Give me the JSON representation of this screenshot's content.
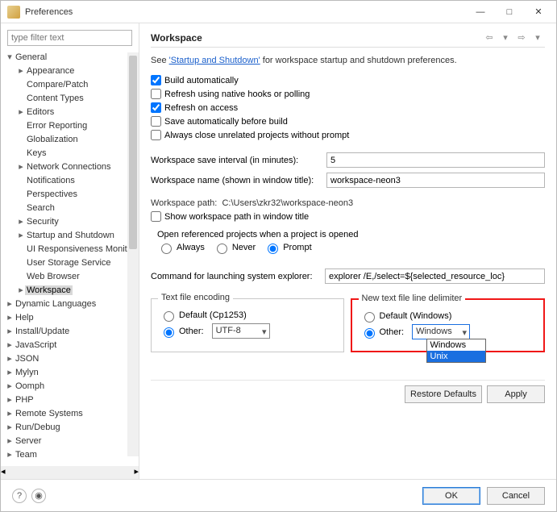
{
  "window": {
    "title": "Preferences"
  },
  "filter": {
    "placeholder": "type filter text"
  },
  "tree": {
    "general": "General",
    "general_items": [
      "Appearance",
      "Compare/Patch",
      "Content Types",
      "Editors",
      "Error Reporting",
      "Globalization",
      "Keys",
      "Network Connections",
      "Notifications",
      "Perspectives",
      "Search",
      "Security",
      "Startup and Shutdown",
      "UI Responsiveness Monitoring",
      "User Storage Service",
      "Web Browser",
      "Workspace"
    ],
    "general_expandable": {
      "Appearance": true,
      "Editors": true,
      "Network Connections": true,
      "Security": true,
      "Startup and Shutdown": true,
      "Workspace": true
    },
    "others": [
      "Dynamic Languages",
      "Help",
      "Install/Update",
      "JavaScript",
      "JSON",
      "Mylyn",
      "Oomph",
      "PHP",
      "Remote Systems",
      "Run/Debug",
      "Server",
      "Team"
    ]
  },
  "page": {
    "heading": "Workspace",
    "intro_prefix": "See ",
    "intro_link": "'Startup and Shutdown'",
    "intro_suffix": " for workspace startup and shutdown preferences.",
    "chk_build": "Build automatically",
    "chk_refresh_native": "Refresh using native hooks or polling",
    "chk_refresh_access": "Refresh on access",
    "chk_save_before": "Save automatically before build",
    "chk_close_unrelated": "Always close unrelated projects without prompt",
    "lbl_save_interval": "Workspace save interval (in minutes):",
    "val_save_interval": "5",
    "lbl_ws_name": "Workspace name (shown in window title):",
    "val_ws_name": "workspace-neon3",
    "lbl_ws_path": "Workspace path:",
    "val_ws_path": "C:\\Users\\zkr32\\workspace-neon3",
    "chk_show_path": "Show workspace path in window title",
    "lbl_open_ref": "Open referenced projects when a project is opened",
    "radio_always": "Always",
    "radio_never": "Never",
    "radio_prompt": "Prompt",
    "lbl_cmd": "Command for launching system explorer:",
    "val_cmd": "explorer /E,/select=${selected_resource_loc}",
    "grp_encoding": "Text file encoding",
    "enc_default": "Default (Cp1253)",
    "enc_other": "Other:",
    "enc_value": "UTF-8",
    "grp_delim": "New text file line delimiter",
    "delim_default": "Default (Windows)",
    "delim_other": "Other:",
    "delim_value": "Windows",
    "delim_options": [
      "Windows",
      "Unix"
    ],
    "btn_restore": "Restore Defaults",
    "btn_apply": "Apply",
    "btn_ok": "OK",
    "btn_cancel": "Cancel"
  }
}
